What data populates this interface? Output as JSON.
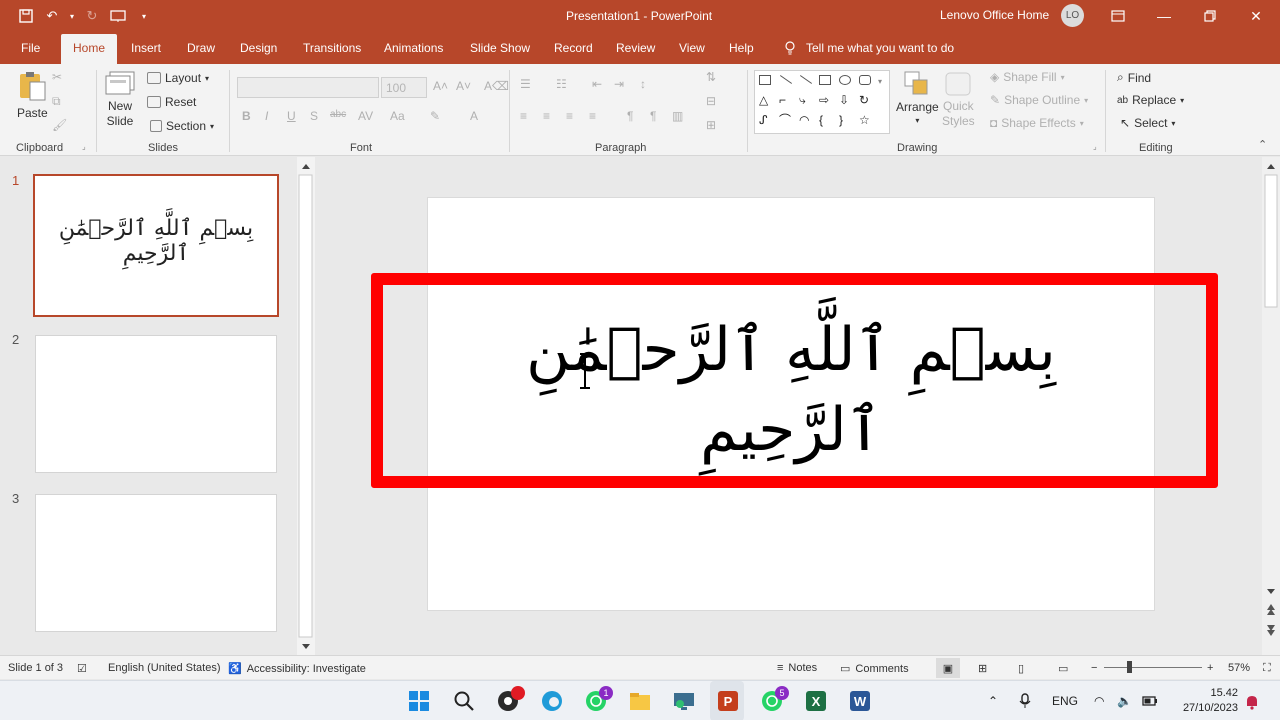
{
  "window": {
    "title": "Presentation1  -  PowerPoint",
    "account": "Lenovo Office Home",
    "avatar_initials": "LO"
  },
  "tabs": [
    "File",
    "Home",
    "Insert",
    "Draw",
    "Design",
    "Transitions",
    "Animations",
    "Slide Show",
    "Record",
    "Review",
    "View",
    "Help"
  ],
  "active_tab": "Home",
  "tell_me": "Tell me what you want to do",
  "ribbon": {
    "clipboard": {
      "paste": "Paste",
      "label": "Clipboard"
    },
    "slides": {
      "new_slide_1": "New",
      "new_slide_2": "Slide",
      "layout": "Layout",
      "reset": "Reset",
      "section": "Section",
      "label": "Slides"
    },
    "font": {
      "size": "100",
      "label": "Font"
    },
    "paragraph": {
      "label": "Paragraph"
    },
    "drawing": {
      "arrange": "Arrange",
      "quick_styles_1": "Quick",
      "quick_styles_2": "Styles",
      "shape_fill": "Shape Fill",
      "shape_outline": "Shape Outline",
      "shape_effects": "Shape Effects",
      "label": "Drawing"
    },
    "editing": {
      "find": "Find",
      "replace": "Replace",
      "select": "Select",
      "label": "Editing"
    }
  },
  "thumbnails": [
    {
      "num": "1",
      "text": "بِسۡمِ ٱللَّهِ ٱلرَّحۡمَٰنِ ٱلرَّحِيمِ",
      "selected": true
    },
    {
      "num": "2",
      "text": "",
      "selected": false
    },
    {
      "num": "3",
      "text": "",
      "selected": false
    }
  ],
  "slide": {
    "text": "بِسۡمِ ٱللَّهِ ٱلرَّحۡمَٰنِ ٱلرَّحِيمِ",
    "highlight_color": "#ff0000"
  },
  "status": {
    "slide_info": "Slide 1 of 3",
    "language": "English (United States)",
    "accessibility": "Accessibility: Investigate",
    "notes": "Notes",
    "comments": "Comments",
    "zoom": "57%"
  },
  "taskbar": {
    "lang": "ENG",
    "time": "15.42",
    "date": "27/10/2023",
    "badges": {
      "chat": "1",
      "whatsapp": "5"
    }
  },
  "colors": {
    "accent": "#b7472a"
  }
}
